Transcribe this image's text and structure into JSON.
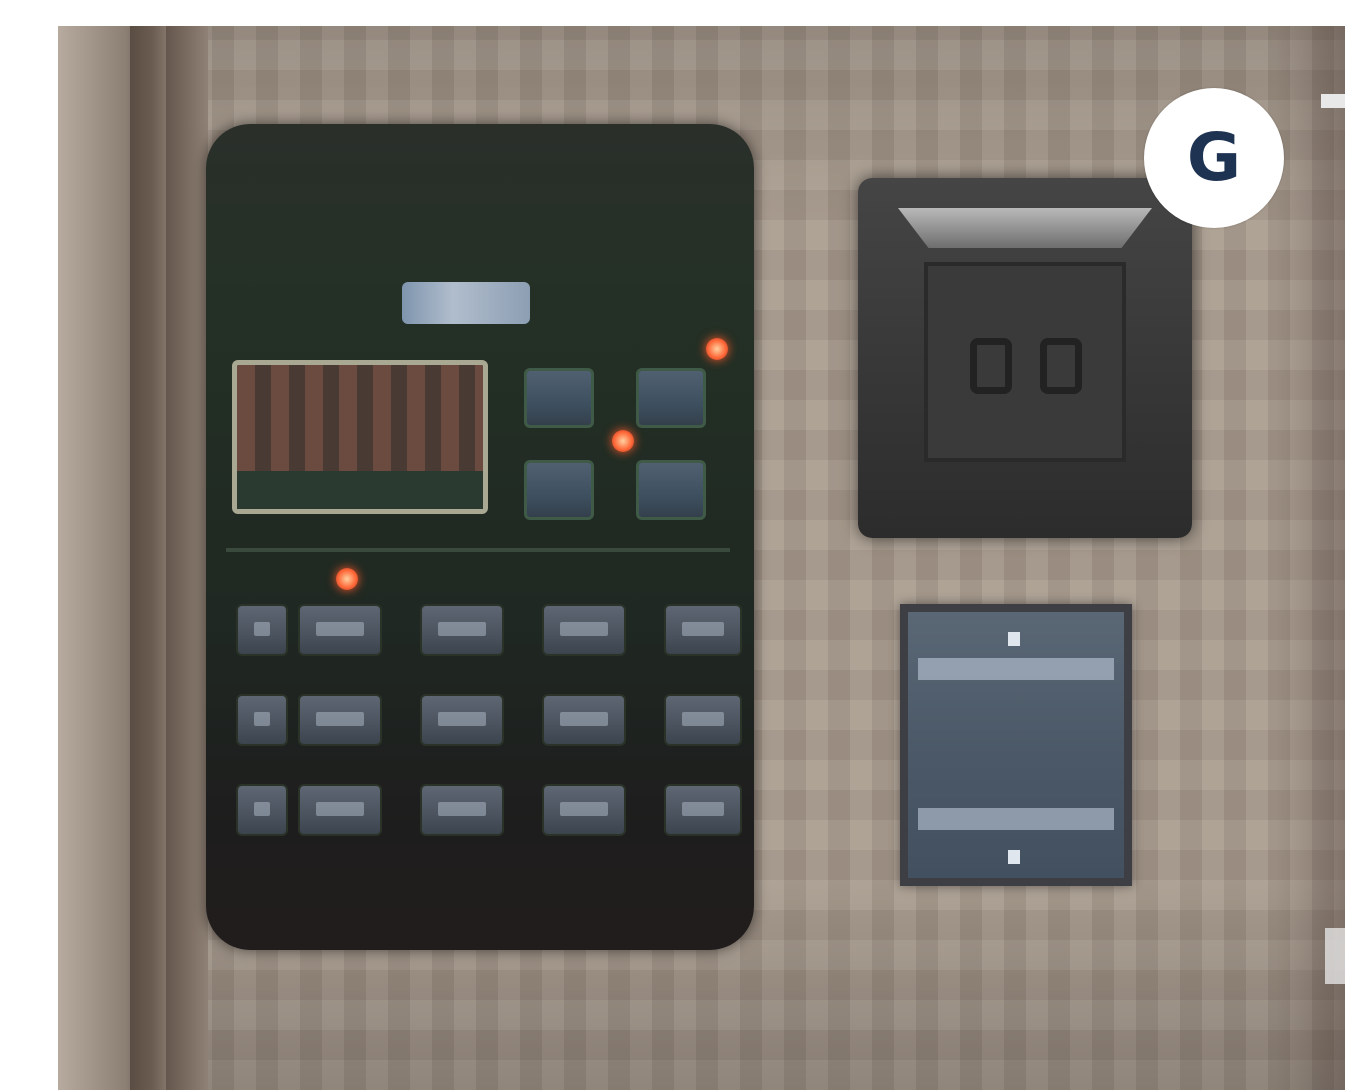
{
  "badge": {
    "label": "G",
    "text_color": "#1e3352",
    "background_color": "#ffffff"
  },
  "photo": {
    "subject_elements": [
      "control-panel",
      "thermostat",
      "switch-plate"
    ],
    "control_panel": {
      "key_rows": 3,
      "keys_per_row": 4,
      "indicator_led_color": "#ff6a3a"
    }
  }
}
